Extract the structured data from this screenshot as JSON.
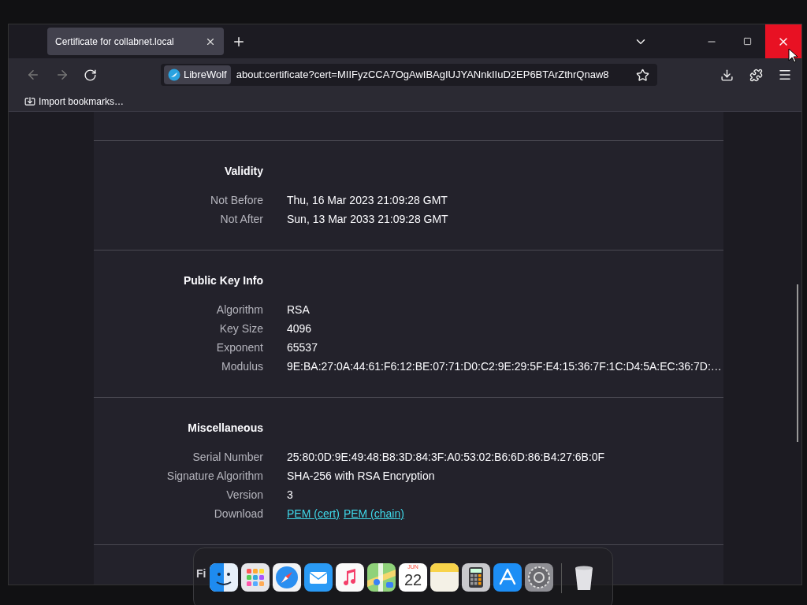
{
  "tab": {
    "title": "Certificate for collabnet.local",
    "selected": true
  },
  "address_bar": {
    "identity": "LibreWolf",
    "url": "about:certificate?cert=MIIFyzCCA7OgAwIBAgIUJYANnkIIuD2EP6BTArZthrQnaw8"
  },
  "bookmarks": [
    {
      "label": "Import bookmarks…"
    }
  ],
  "sections": [
    {
      "title": "Validity",
      "rows": [
        {
          "label": "Not Before",
          "value": "Thu, 16 Mar 2023 21:09:28 GMT"
        },
        {
          "label": "Not After",
          "value": "Sun, 13 Mar 2033 21:09:28 GMT"
        }
      ]
    },
    {
      "title": "Public Key Info",
      "rows": [
        {
          "label": "Algorithm",
          "value": "RSA"
        },
        {
          "label": "Key Size",
          "value": "4096"
        },
        {
          "label": "Exponent",
          "value": "65537"
        },
        {
          "label": "Modulus",
          "value": "9E:BA:27:0A:44:61:F6:12:BE:07:71:D0:C2:9E:29:5F:E4:15:36:7F:1C:D4:5A:EC:36:7D:…"
        }
      ]
    },
    {
      "title": "Miscellaneous",
      "rows": [
        {
          "label": "Serial Number",
          "value": "25:80:0D:9E:49:48:B8:3D:84:3F:A0:53:02:B6:6D:86:B4:27:6B:0F"
        },
        {
          "label": "Signature Algorithm",
          "value": "SHA-256 with RSA Encryption"
        },
        {
          "label": "Version",
          "value": "3"
        },
        {
          "label": "Download",
          "links": [
            "PEM (cert)",
            "PEM (chain)"
          ]
        }
      ]
    }
  ],
  "partial_heading": "Fi",
  "dock": {
    "items": [
      {
        "kind": "finder"
      },
      {
        "kind": "grid"
      },
      {
        "kind": "compass"
      },
      {
        "kind": "mail"
      },
      {
        "kind": "music"
      },
      {
        "kind": "map"
      },
      {
        "kind": "calendar",
        "month": "JUN",
        "day": "22"
      },
      {
        "kind": "notes"
      },
      {
        "kind": "calculator"
      },
      {
        "kind": "store"
      },
      {
        "kind": "settings"
      },
      {
        "kind": "separator"
      },
      {
        "kind": "trash"
      }
    ]
  }
}
